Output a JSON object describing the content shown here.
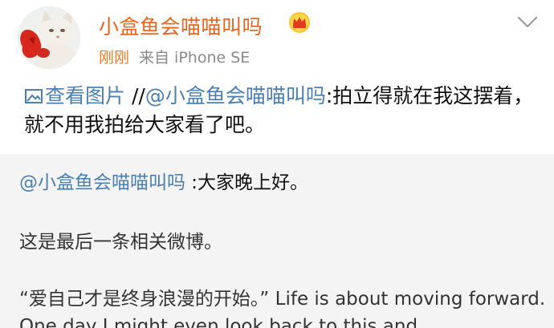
{
  "post": {
    "username": "小盒鱼会喵喵叫吗",
    "timestamp": "刚刚",
    "source": "来自 iPhone SE",
    "view_pic_label": "查看图片",
    "repost_sep": "//",
    "repost_mention": "@小盒鱼会喵喵叫吗",
    "repost_text": ":拍立得就在我这摆着，就不用我拍给大家看了吧。"
  },
  "quoted": {
    "mention": "@小盒鱼会喵喵叫吗",
    "greeting": " :大家晚上好。",
    "line2": "这是最后一条相关微博。",
    "line3": "“爱自己才是终身浪漫的开始。” Life is about moving forward. One day I might even look back to this and"
  },
  "colors": {
    "username": "#e8641f",
    "link": "#4a7fb5",
    "quote_bg": "#f4f4f4"
  },
  "icons": {
    "avatar": "cat-avatar",
    "crown": "crown-icon",
    "dropdown": "chevron-down-icon",
    "picture": "image-icon"
  }
}
